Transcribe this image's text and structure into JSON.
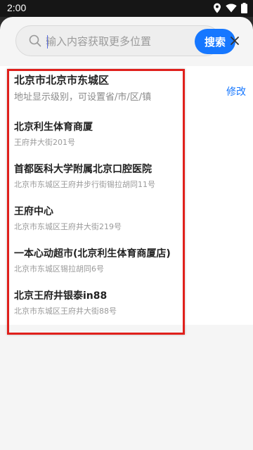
{
  "status_bar": {
    "time": "2:00",
    "icons": [
      "location-icon",
      "wifi-icon",
      "battery-icon"
    ]
  },
  "search": {
    "placeholder": "输入内容获取更多位置",
    "value": "",
    "button_label": "搜索"
  },
  "close_label": "×",
  "current_address": {
    "title": "北京市北京市东城区",
    "subtitle": "地址显示级别，可设置省/市/区/镇",
    "modify_label": "修改"
  },
  "poi_list": [
    {
      "name": "北京利生体育商厦",
      "address": "王府井大街201号"
    },
    {
      "name": "首都医科大学附属北京口腔医院",
      "address": "北京市东城区王府井步行街锡拉胡同11号"
    },
    {
      "name": "王府中心",
      "address": "北京市东城区王府井大街219号"
    },
    {
      "name": "一本心动超市(北京利生体育商厦店)",
      "address": "北京市东城区锡拉胡同6号"
    },
    {
      "name": "北京王府井银泰in88",
      "address": "北京市东城区王府井大街88号"
    }
  ],
  "colors": {
    "accent": "#1677ff",
    "highlight": "#e0201c"
  }
}
